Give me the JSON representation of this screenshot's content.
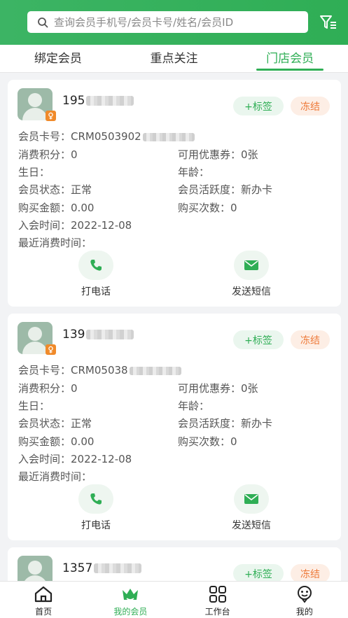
{
  "search": {
    "placeholder": "查询会员手机号/会员卡号/姓名/会员ID"
  },
  "tabs": [
    {
      "label": "绑定会员"
    },
    {
      "label": "重点关注"
    },
    {
      "label": "门店会员"
    }
  ],
  "labels": {
    "card_no": "会员卡号：",
    "points": "消费积分：",
    "coupons": "可用优惠券：",
    "birthday": "生日：",
    "age": "年龄：",
    "status": "会员状态：",
    "activity": "会员活跃度：",
    "amount": "购买金额：",
    "count": "购买次数：",
    "join": "入会时间：",
    "last": "最近消费时间：",
    "tag_button": "+标签",
    "freeze_button": "冻结",
    "call": "打电话",
    "sms": "发送短信"
  },
  "members": [
    {
      "phone_prefix": "195",
      "card_prefix": "CRM0503902",
      "points": "0",
      "coupons": "0张",
      "status": "正常",
      "activity": "新办卡",
      "amount": "0.00",
      "count": "0",
      "join": "2022-12-08"
    },
    {
      "phone_prefix": "139",
      "card_prefix": "CRM05038",
      "points": "0",
      "coupons": "0张",
      "status": "正常",
      "activity": "新办卡",
      "amount": "0.00",
      "count": "0",
      "join": "2022-12-08"
    },
    {
      "phone_prefix": "1357"
    }
  ],
  "nav": [
    {
      "label": "首页",
      "icon": "home-icon"
    },
    {
      "label": "我的会员",
      "icon": "crown-icon"
    },
    {
      "label": "工作台",
      "icon": "grid-icon"
    },
    {
      "label": "我的",
      "icon": "smile-icon"
    }
  ],
  "colors": {
    "primary": "#2fae55",
    "freeze": "#ee7a3a",
    "badge": "#f08a2a"
  }
}
